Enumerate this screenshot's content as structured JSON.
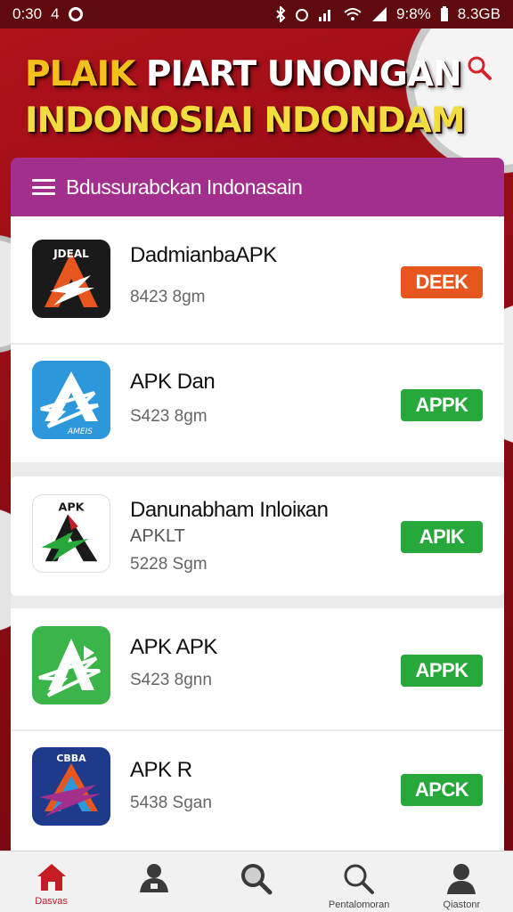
{
  "status_bar": {
    "time": "0:30",
    "left_extra": "4",
    "right_text": "9:8%",
    "storage": "8.3GB"
  },
  "hero": {
    "title_yellow": "PLAIK",
    "title_line1_rest": " PIART UNONGAN",
    "title_line2": "INDONOSIAI NDONDAM"
  },
  "category": {
    "label": "Bdussurabckan Indonasain"
  },
  "apps": [
    {
      "name": "DadmianbaAPK",
      "sub": "",
      "meta": "8423 8gm",
      "action": "DEEK",
      "action_color": "#e8561f",
      "icon_bg": "#1a1a1a",
      "icon_fg": "#e8561f",
      "icon_text": "JDEAL"
    },
    {
      "name": "APK Dan",
      "sub": "",
      "meta": "S423 8gm",
      "action": "APPK",
      "action_color": "#27a83a",
      "icon_bg": "#2d97dc",
      "icon_fg": "#ffffff",
      "icon_text": "AMEIS"
    },
    {
      "name": "Danunabham Inloiкan",
      "sub": "APKLT",
      "meta": "5228 Sgm",
      "action": "APIK",
      "action_color": "#27a83a",
      "icon_bg": "#ffffff",
      "icon_fg": "#1a1a1a",
      "icon_text": "APK"
    },
    {
      "name": "APK APK",
      "sub": "",
      "meta": "S423 8gnn",
      "action": "APPK",
      "action_color": "#27a83a",
      "icon_bg": "#3bb54a",
      "icon_fg": "#ffffff",
      "icon_text": ""
    },
    {
      "name": "APK R",
      "sub": "",
      "meta": "5438 Sgan",
      "action": "APCK",
      "action_color": "#27a83a",
      "icon_bg": "#1f3a8a",
      "icon_fg": "#e8561f",
      "icon_text": "CBBA"
    }
  ],
  "nav": [
    {
      "label": "Dasvas",
      "icon": "home-icon",
      "active": true
    },
    {
      "label": "",
      "icon": "user-folder-icon",
      "active": false
    },
    {
      "label": "",
      "icon": "search-icon",
      "active": false
    },
    {
      "label": "Pentalomoran",
      "icon": "search-alt-icon",
      "active": false
    },
    {
      "label": "Qiastonr",
      "icon": "profile-icon",
      "active": false
    }
  ]
}
